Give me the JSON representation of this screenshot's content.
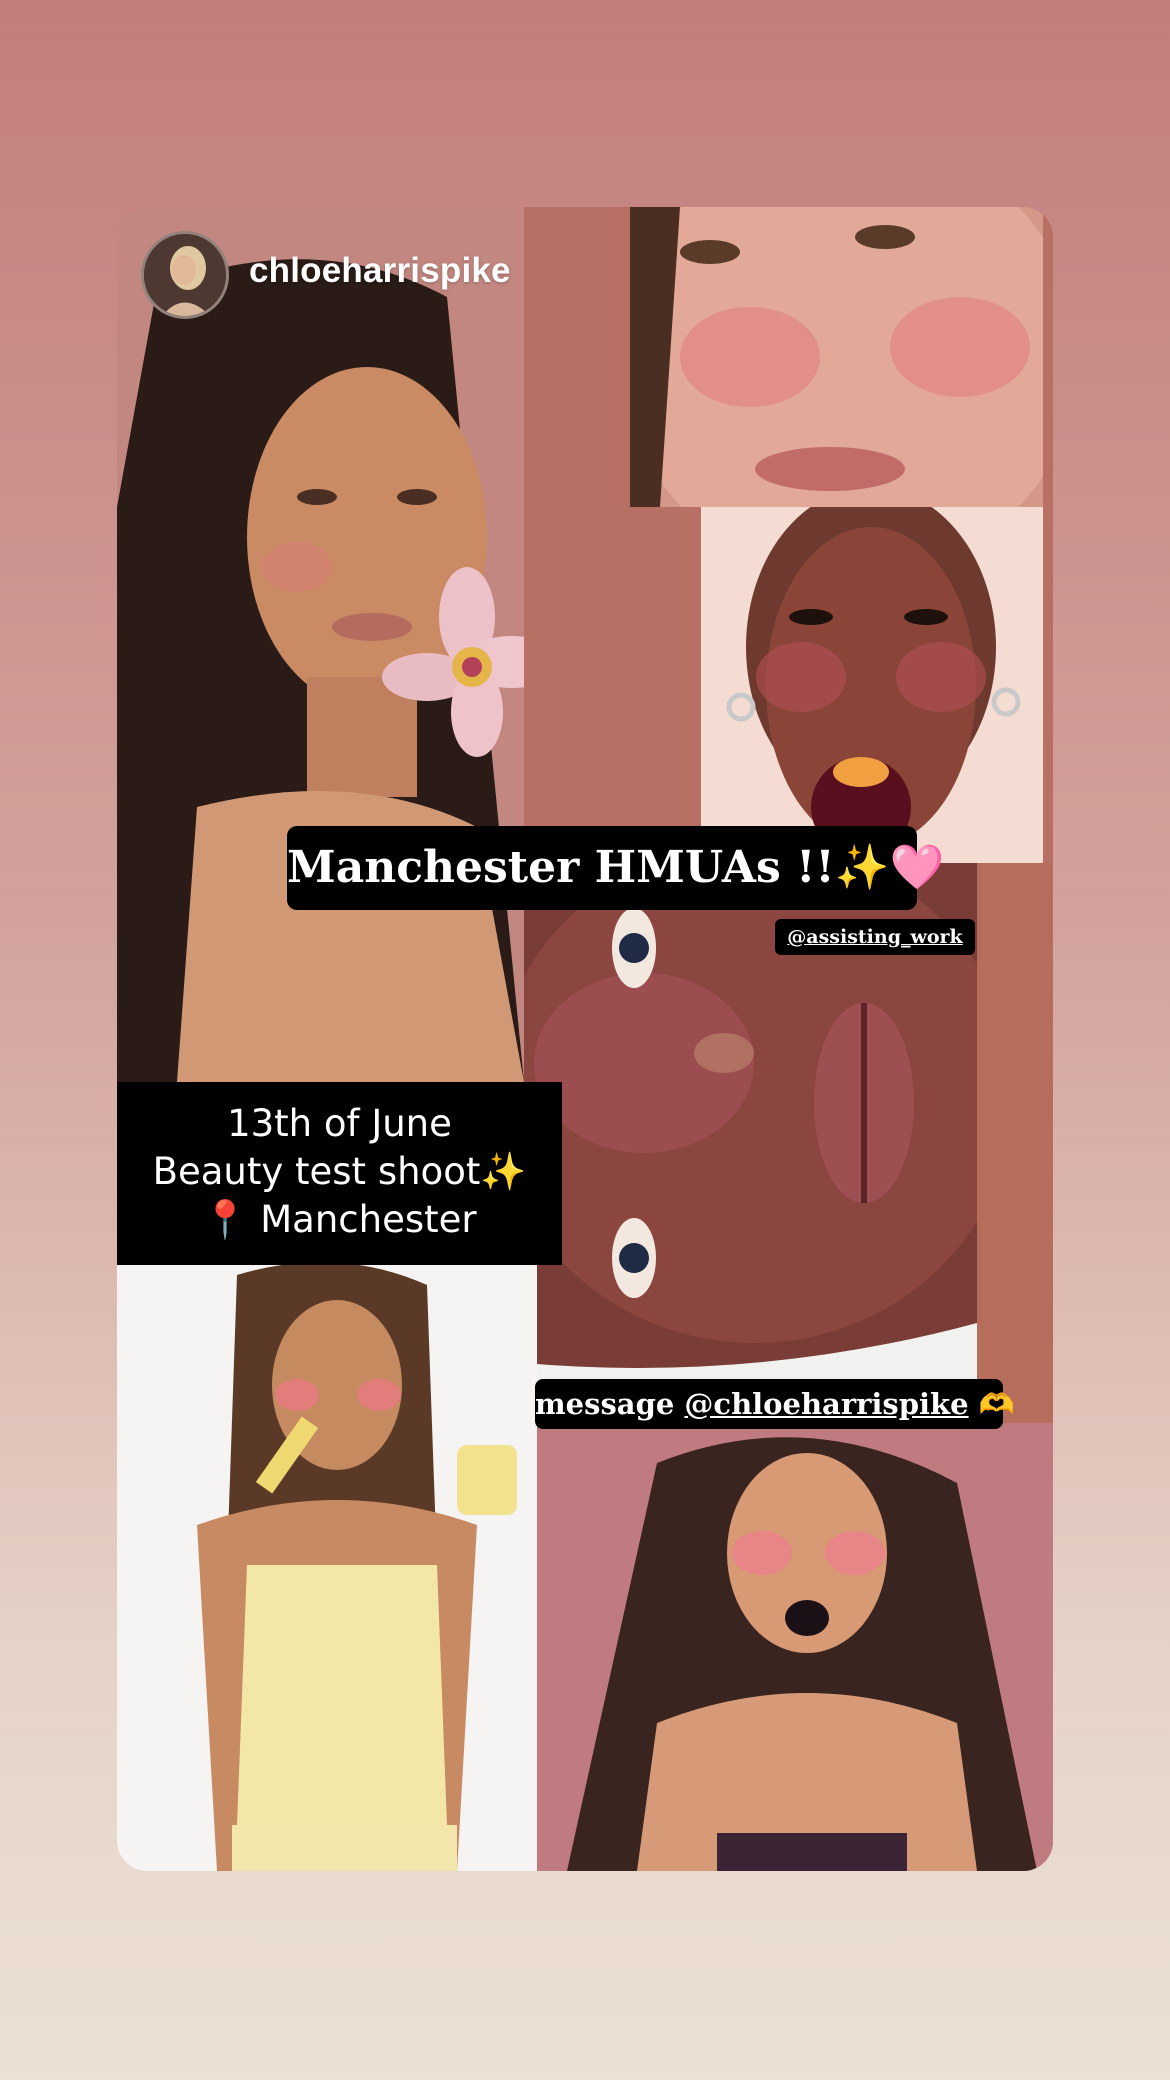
{
  "story": {
    "username": "chloeharrispike",
    "avatar_icon": "profile-avatar",
    "captions": {
      "title": "Manchester HMUAs !!",
      "title_emoji": "✨🩷",
      "assisting_tag": "@assisting_work",
      "message_prefix": "message ",
      "message_handle": "@chloeharrispike",
      "message_emoji": "🫶"
    },
    "event": {
      "line1": "13th of June",
      "line2": "Beauty test shoot",
      "line2_emoji": "✨",
      "line3_emoji": "📍",
      "line3": " Manchester"
    },
    "colors": {
      "background_top": "#c17e7c",
      "background_bottom": "#ebe1d4",
      "caption_bg": "#000000",
      "caption_text": "#ffffff"
    }
  }
}
